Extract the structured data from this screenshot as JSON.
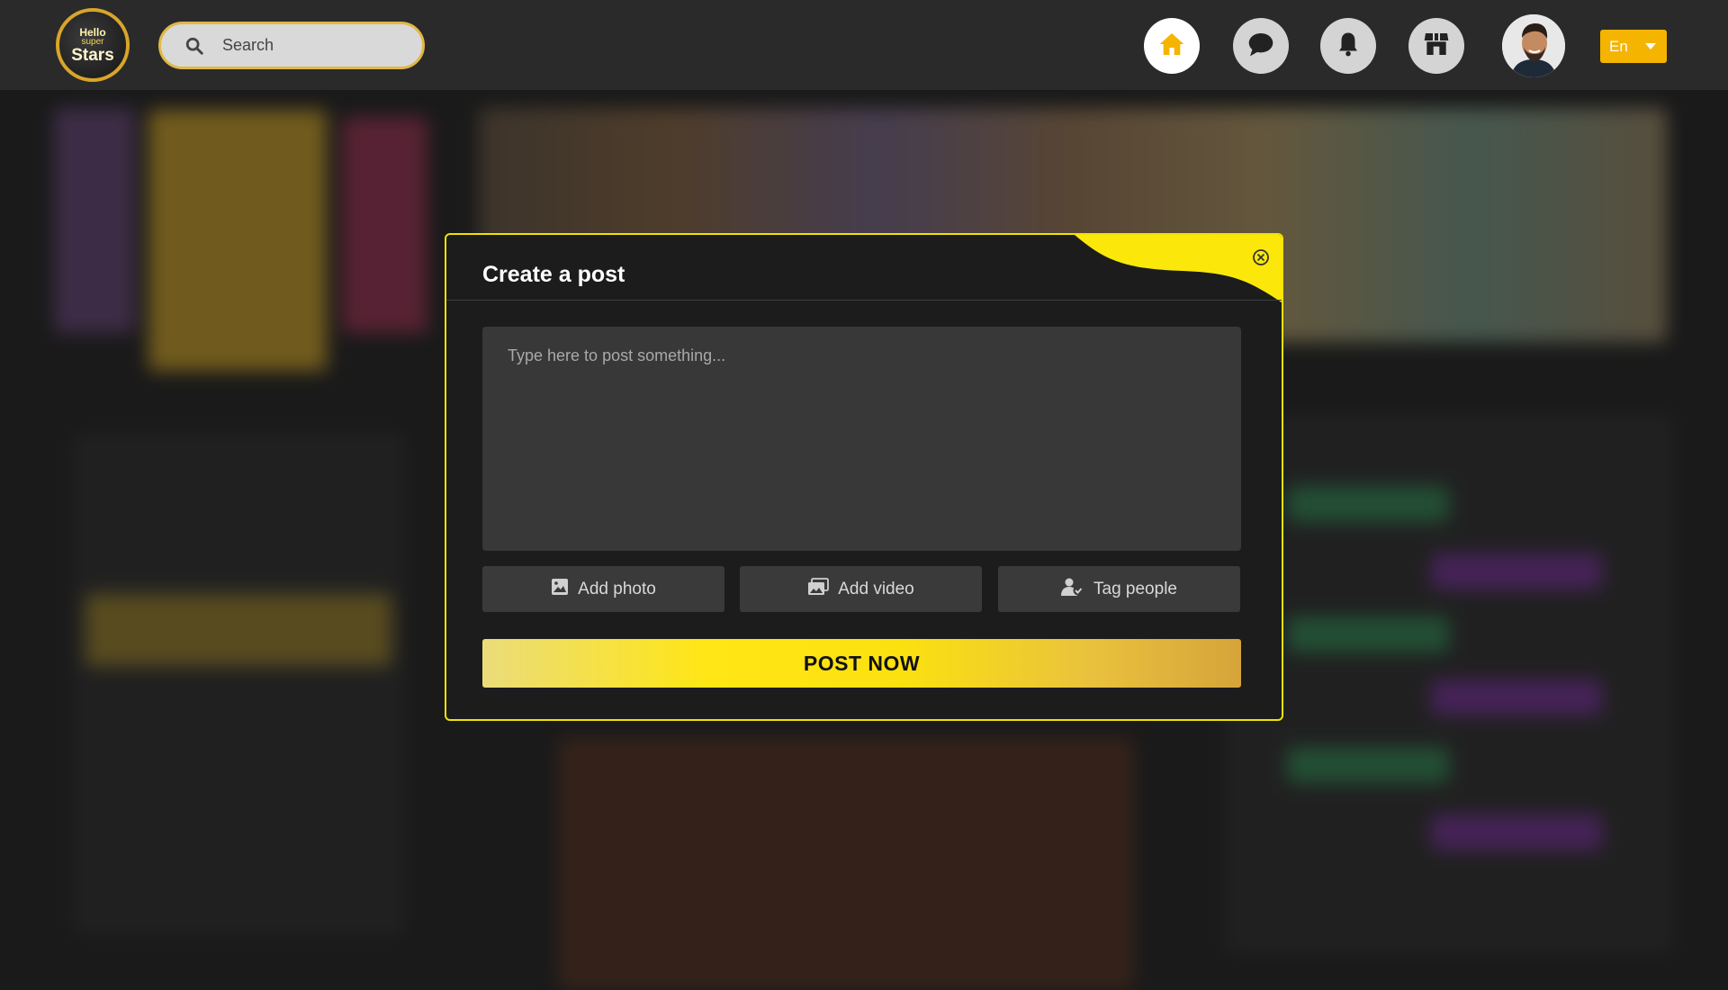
{
  "app": {
    "logo": {
      "line1": "Hello",
      "line2": "super",
      "line3": "Stars"
    },
    "search": {
      "placeholder": "Search",
      "value": ""
    },
    "nav": [
      {
        "name": "home-icon",
        "active": true
      },
      {
        "name": "chat-icon",
        "active": false
      },
      {
        "name": "bell-icon",
        "active": false
      },
      {
        "name": "store-icon",
        "active": false
      }
    ],
    "language": {
      "selected": "En"
    }
  },
  "modal": {
    "title": "Create a post",
    "textarea_placeholder": "Type here to post something...",
    "textarea_value": "",
    "buttons": {
      "add_photo": "Add photo",
      "add_video": "Add video",
      "tag_people": "Tag people"
    },
    "post_label": "POST NOW"
  },
  "colors": {
    "accent_yellow": "#f2e300",
    "language_bg": "#f5b400",
    "topbar_bg": "#2a2a2a"
  }
}
